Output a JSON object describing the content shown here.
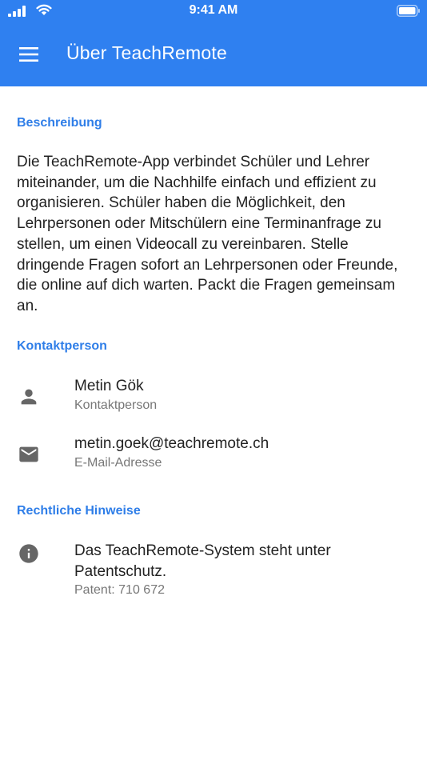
{
  "status_bar": {
    "time": "9:41 AM"
  },
  "app_bar": {
    "title": "Über TeachRemote",
    "menu_icon": "hamburger-menu-icon",
    "background_color": "#2f80f0"
  },
  "sections": {
    "description": {
      "header": "Beschreibung",
      "text": "Die TeachRemote-App verbindet Schüler und Lehrer miteinander, um die Nachhilfe einfach und effizient zu organisieren. Schüler haben die Möglichkeit, den Lehrpersonen oder Mitschülern eine Terminanfrage zu stellen, um einen Videocall zu vereinbaren. Stelle dringende Fragen sofort an Lehrpersonen oder Freunde, die online auf dich warten. Packt die Fragen gemeinsam an."
    },
    "contact": {
      "header": "Kontaktperson",
      "items": [
        {
          "icon": "person-icon",
          "primary": "Metin Gök",
          "secondary": "Kontaktperson"
        },
        {
          "icon": "mail-icon",
          "primary": "metin.goek@teachremote.ch",
          "secondary": "E-Mail-Adresse"
        }
      ]
    },
    "legal": {
      "header": "Rechtliche Hinweise",
      "items": [
        {
          "icon": "info-icon",
          "primary": "Das TeachRemote-System steht unter Patentschutz.",
          "secondary": "Patent: 710 672"
        }
      ]
    }
  },
  "colors": {
    "accent": "#2f7ee8",
    "icon_gray": "#666666",
    "secondary_text": "#777777"
  }
}
